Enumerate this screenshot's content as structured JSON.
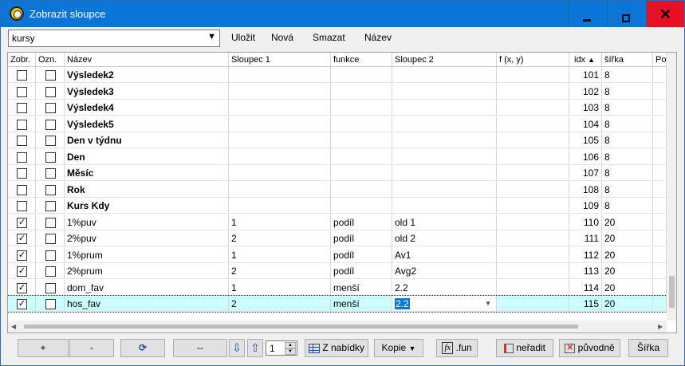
{
  "window": {
    "title": "Zobrazit sloupce"
  },
  "toolbar": {
    "combo_value": "kursy",
    "save_label": "Uložit",
    "new_label": "Nová",
    "delete_label": "Smazat",
    "name_label": "Název"
  },
  "grid": {
    "headers": {
      "zobr": "Zobr.",
      "ozn": "Ozn.",
      "nazev": "Název",
      "sloupec1": "Sloupec 1",
      "funkce": "funkce",
      "sloupec2": "Sloupec 2",
      "fxy": "f (x, y)",
      "idx": "idx",
      "sirka": "šířka",
      "po": "Po"
    },
    "rows": [
      {
        "zobr": false,
        "ozn": false,
        "nazev": "Výsledek2",
        "bold": true,
        "s1": "",
        "fn": "",
        "s2": "",
        "fxy": "",
        "idx": "101",
        "sirka": "8"
      },
      {
        "zobr": false,
        "ozn": false,
        "nazev": "Výsledek3",
        "bold": true,
        "s1": "",
        "fn": "",
        "s2": "",
        "fxy": "",
        "idx": "102",
        "sirka": "8"
      },
      {
        "zobr": false,
        "ozn": false,
        "nazev": "Výsledek4",
        "bold": true,
        "s1": "",
        "fn": "",
        "s2": "",
        "fxy": "",
        "idx": "103",
        "sirka": "8"
      },
      {
        "zobr": false,
        "ozn": false,
        "nazev": "Výsledek5",
        "bold": true,
        "s1": "",
        "fn": "",
        "s2": "",
        "fxy": "",
        "idx": "104",
        "sirka": "8"
      },
      {
        "zobr": false,
        "ozn": false,
        "nazev": "Den v týdnu",
        "bold": true,
        "s1": "",
        "fn": "",
        "s2": "",
        "fxy": "",
        "idx": "105",
        "sirka": "8"
      },
      {
        "zobr": false,
        "ozn": false,
        "nazev": "Den",
        "bold": true,
        "s1": "",
        "fn": "",
        "s2": "",
        "fxy": "",
        "idx": "106",
        "sirka": "8"
      },
      {
        "zobr": false,
        "ozn": false,
        "nazev": "Měsíc",
        "bold": true,
        "s1": "",
        "fn": "",
        "s2": "",
        "fxy": "",
        "idx": "107",
        "sirka": "8"
      },
      {
        "zobr": false,
        "ozn": false,
        "nazev": "Rok",
        "bold": true,
        "s1": "",
        "fn": "",
        "s2": "",
        "fxy": "",
        "idx": "108",
        "sirka": "8"
      },
      {
        "zobr": false,
        "ozn": false,
        "nazev": "Kurs Kdy",
        "bold": true,
        "s1": "",
        "fn": "",
        "s2": "",
        "fxy": "",
        "idx": "109",
        "sirka": "8"
      },
      {
        "zobr": true,
        "ozn": false,
        "nazev": "1%puv",
        "bold": false,
        "s1": "1",
        "fn": "podíl",
        "s2": "old 1",
        "fxy": "",
        "idx": "110",
        "sirka": "20"
      },
      {
        "zobr": true,
        "ozn": false,
        "nazev": "2%puv",
        "bold": false,
        "s1": "2",
        "fn": "podíl",
        "s2": "old 2",
        "fxy": "",
        "idx": "111",
        "sirka": "20"
      },
      {
        "zobr": true,
        "ozn": false,
        "nazev": "1%prum",
        "bold": false,
        "s1": "1",
        "fn": "podíl",
        "s2": "Av1",
        "fxy": "",
        "idx": "112",
        "sirka": "20"
      },
      {
        "zobr": true,
        "ozn": false,
        "nazev": "2%prum",
        "bold": false,
        "s1": "2",
        "fn": "podíl",
        "s2": "Avg2",
        "fxy": "",
        "idx": "113",
        "sirka": "20"
      },
      {
        "zobr": true,
        "ozn": false,
        "nazev": "dom_fav",
        "bold": false,
        "s1": "1",
        "fn": "menší",
        "s2": "2.2",
        "fxy": "",
        "idx": "114",
        "sirka": "20"
      },
      {
        "zobr": true,
        "ozn": false,
        "nazev": "hos_fav",
        "bold": false,
        "s1": "2",
        "fn": "menší",
        "s2": "2.2",
        "fxy": "",
        "idx": "115",
        "sirka": "20",
        "selected": true
      }
    ]
  },
  "bottom": {
    "plus_label": "+",
    "minus_label": "-",
    "double_minus_label": "--",
    "spin_value": "1",
    "z_nabidky_label": "Z nabídky",
    "kopie_label": "Kopie",
    "fun_label": ".fun",
    "neradit_label": "neřadit",
    "puvodne_label": "původně",
    "sirka_label": "Šířka"
  },
  "icons": {
    "app": "app-logo-icon",
    "refresh": "refresh-icon",
    "down": "arrow-down-icon",
    "up": "arrow-up-icon"
  }
}
